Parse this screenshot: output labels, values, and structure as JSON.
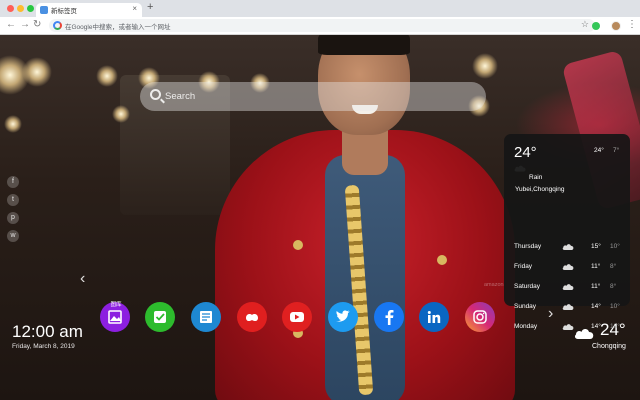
{
  "browser": {
    "tab_title": "新标签页",
    "tab_close": "×",
    "new_tab": "+",
    "omnibox_placeholder": "在Google中搜索，或者输入一个网址",
    "nav_back": "←",
    "nav_forward": "→",
    "nav_reload": "↻",
    "star": "☆",
    "menu": "⋮"
  },
  "search": {
    "placeholder": "Search"
  },
  "social_links": [
    {
      "icon": "facebook-icon",
      "glyph": "f"
    },
    {
      "icon": "twitter-icon",
      "glyph": "t"
    },
    {
      "icon": "pinterest-icon",
      "glyph": "p"
    },
    {
      "icon": "wechat-icon",
      "glyph": "w"
    }
  ],
  "apps": [
    {
      "name": "gallery",
      "icon": "image-icon",
      "color": "#8c1fe0",
      "label": "图库"
    },
    {
      "name": "todo",
      "icon": "check-icon",
      "color": "#2dbb2d"
    },
    {
      "name": "notes",
      "icon": "notes-icon",
      "color": "#1e88d2"
    },
    {
      "name": "games",
      "icon": "gamepad-icon",
      "color": "#e01f1f"
    },
    {
      "name": "youtube",
      "icon": "youtube-icon",
      "color": "#e02020"
    },
    {
      "name": "twitter",
      "icon": "twitter-icon",
      "color": "#1d9bf0"
    },
    {
      "name": "facebook",
      "icon": "facebook-icon",
      "color": "#1877f2"
    },
    {
      "name": "linkedin",
      "icon": "linkedin-icon",
      "color": "#0a66c2"
    },
    {
      "name": "instagram",
      "icon": "instagram-icon",
      "color": "#d62976"
    }
  ],
  "arrows": {
    "left": "‹",
    "right": "›"
  },
  "clock": {
    "time": "12:00 am",
    "date": "Friday, March 8, 2019"
  },
  "weather_corner": {
    "temp": "24°",
    "city": "Chongqing"
  },
  "weather_panel": {
    "temp": "24°",
    "high": "24°",
    "low": "7°",
    "condition": "Rain",
    "location": "Yubei,Chongqing",
    "forecast": [
      {
        "day": "Thursday",
        "high": "15°",
        "low": "10°"
      },
      {
        "day": "Friday",
        "high": "11°",
        "low": "8°"
      },
      {
        "day": "Saturday",
        "high": "11°",
        "low": "8°"
      },
      {
        "day": "Sunday",
        "high": "14°",
        "low": "10°"
      },
      {
        "day": "Monday",
        "high": "14°",
        "low": "10°"
      }
    ]
  },
  "watermark": "amazon"
}
